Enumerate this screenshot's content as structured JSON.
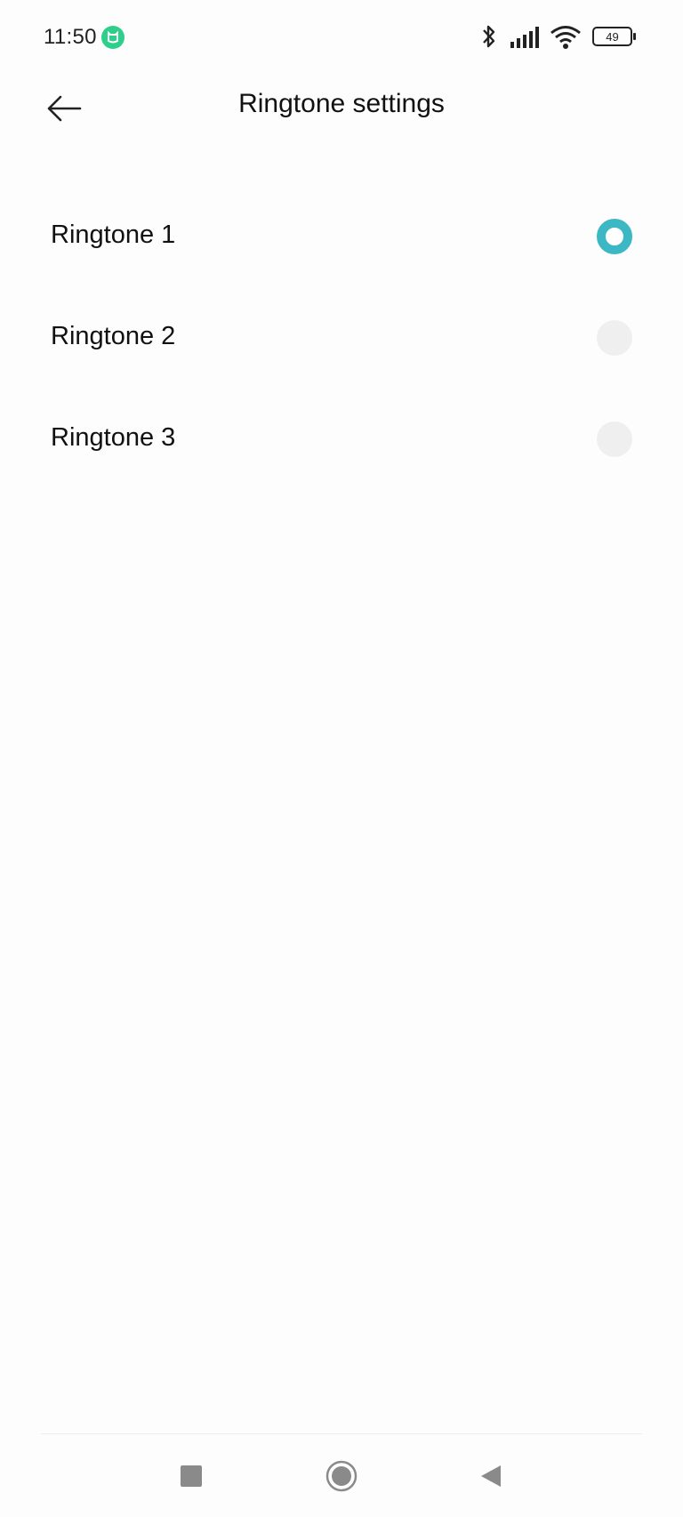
{
  "status_bar": {
    "time": "11:50",
    "battery": "49",
    "icons": [
      "app-notification-icon",
      "bluetooth-icon",
      "signal-icon",
      "wifi-icon",
      "battery-icon"
    ]
  },
  "header": {
    "title": "Ringtone settings",
    "back_icon": "arrow-left-icon"
  },
  "options": [
    {
      "label": "Ringtone 1",
      "selected": true
    },
    {
      "label": "Ringtone 2",
      "selected": false
    },
    {
      "label": "Ringtone 3",
      "selected": false
    }
  ],
  "nav_bar": {
    "icons": [
      "recents-square-icon",
      "home-circle-icon",
      "back-triangle-icon"
    ]
  },
  "colors": {
    "accent": "#3cb7c4",
    "radio_unselected": "#efefef",
    "notification": "#2ecf8a"
  }
}
